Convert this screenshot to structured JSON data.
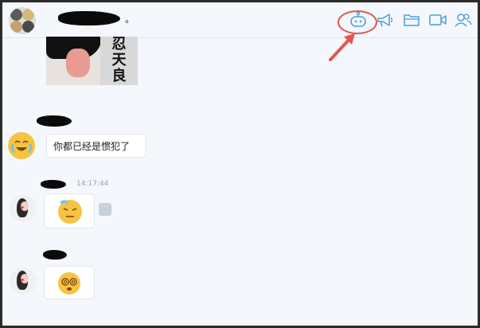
{
  "header": {
    "group_name_suffix": "。",
    "icons": [
      "robot-icon",
      "megaphone-icon",
      "folder-icon",
      "video-call-icon",
      "members-icon"
    ]
  },
  "messages": [
    {
      "type": "image",
      "sticker_text": "忍\n天\n良"
    },
    {
      "type": "text",
      "text": "你都已经是惯犯了",
      "avatar": "crying-laughing-emoji-avatar"
    },
    {
      "type": "emoji",
      "timestamp": "14:17:44",
      "emoji": "sweating-emoji",
      "more_label": "···"
    },
    {
      "type": "emoji",
      "emoji": "dizzy-emoji"
    }
  ],
  "annotation": {
    "color": "#e2574c",
    "target": "robot-icon"
  },
  "colors": {
    "icon_blue": "#4a9fd8",
    "background": "#f4f7fc"
  }
}
